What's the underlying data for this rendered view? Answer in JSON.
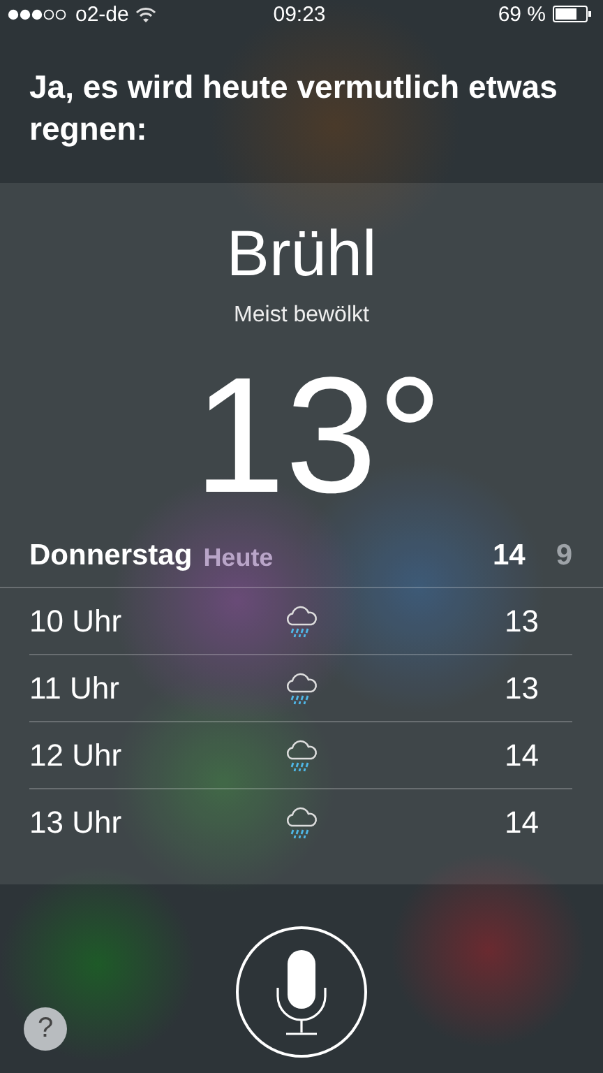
{
  "status_bar": {
    "carrier": "o2-de",
    "time": "09:23",
    "battery": "69 %"
  },
  "answer": "Ja, es wird heute vermutlich etwas regnen:",
  "weather": {
    "city": "Brühl",
    "condition": "Meist bewölkt",
    "temperature": "13°",
    "day": "Donnerstag",
    "day_note": "Heute",
    "high": "14",
    "low": "9",
    "hours": [
      {
        "time": "10 Uhr",
        "kind": "rain",
        "temperature": "13"
      },
      {
        "time": "11 Uhr",
        "kind": "rain",
        "temperature": "13"
      },
      {
        "time": "12 Uhr",
        "kind": "rain",
        "temperature": "14"
      },
      {
        "time": "13 Uhr",
        "kind": "rain",
        "temperature": "14"
      }
    ]
  },
  "help_button": "?"
}
